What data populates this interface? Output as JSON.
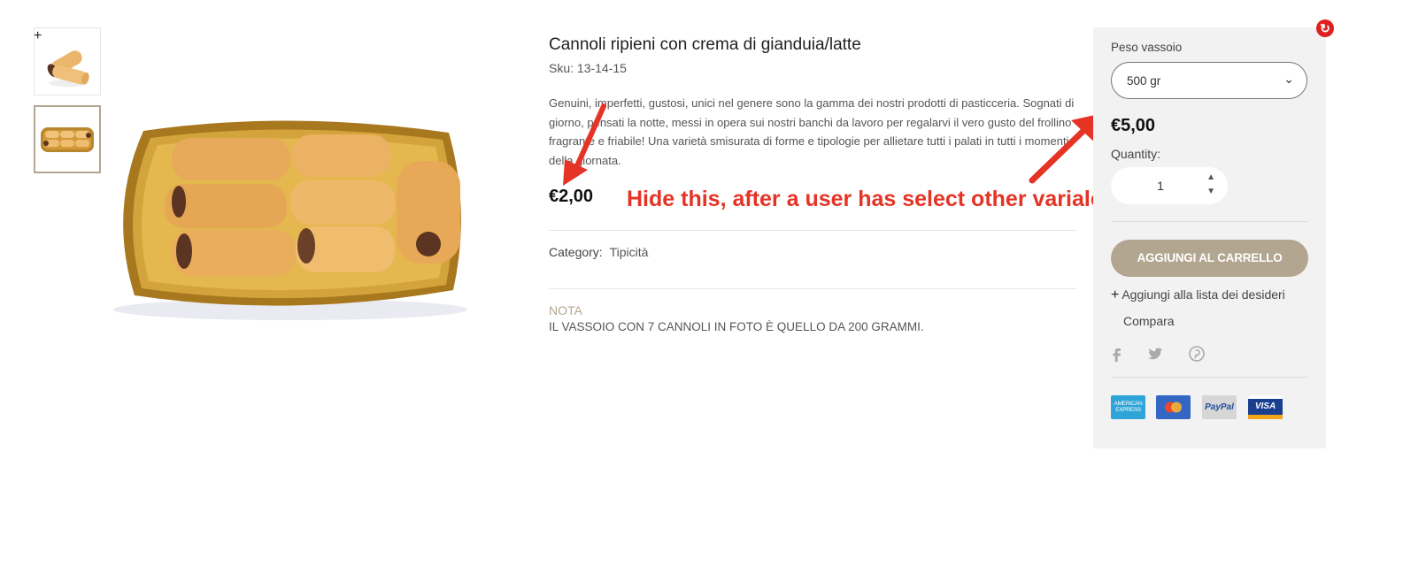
{
  "product": {
    "title": "Cannoli ripieni con crema di gianduia/latte",
    "sku": "Sku: 13-14-15",
    "description": "Genuini, imperfetti, gustosi, unici nel genere sono la gamma dei nostri prodotti di pasticceria. Sognati di giorno, pensati la notte, messi in opera sui nostri banchi da lavoro per regalarvi il vero gusto del frollino fragrante e friabile! Una varietà smisurata di forme e tipologie per allietare tutti i palati in tutti i momenti della giornata.",
    "price": "€2,00",
    "category_label": "Category:",
    "category_value": "Tipicità",
    "note_heading": "NOTA",
    "note_text": "IL VASSOIO CON 7 CANNOLI IN FOTO È QUELLO DA 200 GRAMMI."
  },
  "annotation": {
    "text": "Hide this, after a user has select other variale",
    "color": "#e53325"
  },
  "gallery": {
    "zoom_icon": "plus-icon",
    "thumbnails": [
      "thumbnail-cannoli-single",
      "thumbnail-cannoli-tray"
    ]
  },
  "sidebar": {
    "variation_label": "Peso vassoio",
    "variation_selected": "500 gr",
    "price": "€5,00",
    "quantity_label": "Quantity:",
    "quantity_value": "1",
    "add_to_cart_label": "AGGIUNGI AL CARRELLO",
    "wishlist_label": "Aggiungi alla lista dei desideri",
    "compare_label": "Compara",
    "social_icons": [
      "facebook-icon",
      "twitter-icon",
      "pinterest-icon"
    ],
    "payment_cards": {
      "amex": "AMERICAN EXPRESS",
      "paypal": "PayPal",
      "visa": "VISA"
    }
  },
  "colors": {
    "accent": "#b2a691",
    "sidebar_bg": "#f2f2f2",
    "annotation_red": "#e53325"
  }
}
